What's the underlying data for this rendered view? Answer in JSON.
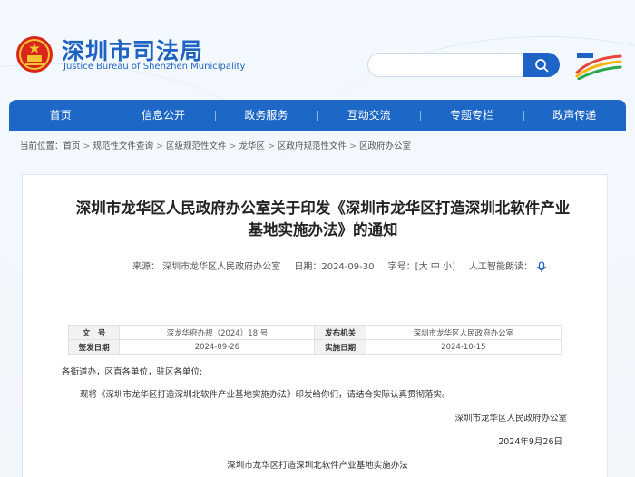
{
  "site": {
    "name": "深圳市司法局",
    "name_en": "Justice Bureau of Shenzhen Municipality"
  },
  "search": {
    "placeholder": "",
    "icon": "search-icon"
  },
  "nav": {
    "items": [
      "首页",
      "信息公开",
      "政务服务",
      "互动交流",
      "专题专栏",
      "政声传递"
    ]
  },
  "breadcrumb": {
    "prefix": "当前位置：",
    "items": [
      "首页",
      "规范性文件查询",
      "区级规范性文件",
      "龙华区",
      "区政府规范性文件",
      "区政府办公室"
    ],
    "separator": ">"
  },
  "article": {
    "title": "深圳市龙华区人民政府办公室关于印发《深圳市龙华区打造深圳北软件产业基地实施办法》的通知",
    "meta": {
      "source_label": "来源：",
      "source": "深圳市龙华区人民政府办公室",
      "date_label": "日期：",
      "date": "2024-09-30",
      "size_label": "字号：",
      "size_open": "[",
      "size_large": "大",
      "size_medium": "中",
      "size_small": "小",
      "size_close": "]",
      "reader_label": "人工智能朗读："
    },
    "info": {
      "doc_no_label": "文　号",
      "doc_no": "深龙华府办规（2024）18 号",
      "issuer_label": "发布机关",
      "issuer": "深圳市龙华区人民政府办公室",
      "sign_date_label": "签发日期",
      "sign_date": "2024-09-26",
      "effective_date_label": "实施日期",
      "effective_date": "2024-10-15"
    },
    "salutation": "各街道办，区直各单位，驻区各单位:",
    "paragraph": "现将《深圳市龙华区打造深圳北软件产业基地实施办法》印发给你们，请结合实际认真贯彻落实。",
    "sign_org": "深圳市龙华区人民政府办公室",
    "sign_date": "2024年9月26日",
    "attachment_title": "深圳市龙华区打造深圳北软件产业基地实施办法"
  },
  "colors": {
    "brand": "#1f63c2",
    "nav": "#1d67c7"
  }
}
